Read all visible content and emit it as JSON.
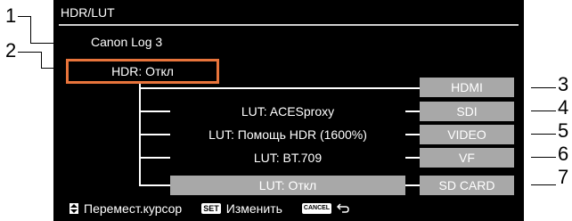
{
  "menu": {
    "title": "HDR/LUT",
    "gamma_label": "Canon Log 3",
    "hdr_label": "HDR: Откл"
  },
  "luts": [
    {
      "label": "LUT: ACESproxy"
    },
    {
      "label": "LUT: Помощь HDR (1600%)"
    },
    {
      "label": "LUT: BT.709"
    },
    {
      "label": "LUT: Откл"
    }
  ],
  "outputs": [
    {
      "label": "HDMI"
    },
    {
      "label": "SDI"
    },
    {
      "label": "VIDEO"
    },
    {
      "label": "VF"
    },
    {
      "label": "SD CARD"
    }
  ],
  "footer": {
    "move_label": "Перемест.курсор",
    "set_key": "SET",
    "set_label": "Изменить",
    "cancel_key": "CANCEL"
  },
  "callouts": [
    "1",
    "2",
    "3",
    "4",
    "5",
    "6",
    "7"
  ],
  "colors": {
    "highlight": "#e8743b",
    "button_gray": "#a8a8a8",
    "background": "#000000"
  }
}
